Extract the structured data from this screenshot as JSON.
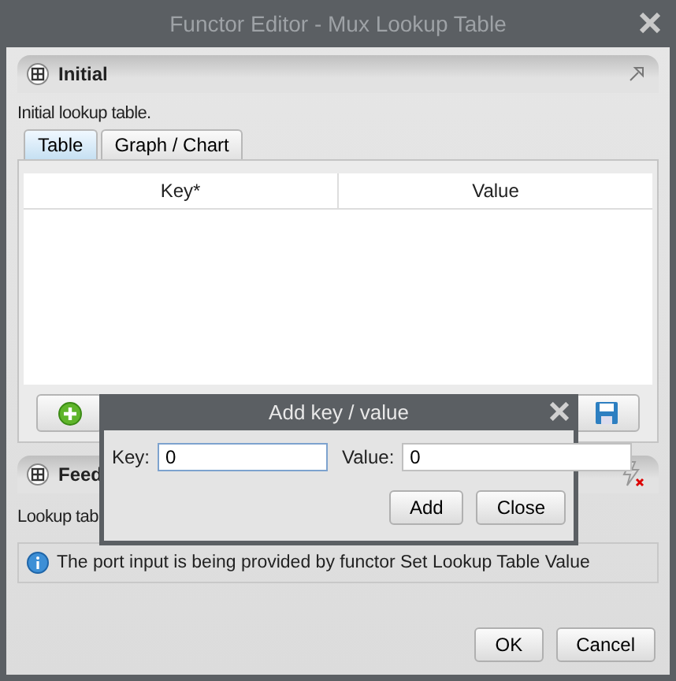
{
  "window": {
    "title": "Functor Editor - Mux Lookup Table"
  },
  "panels": [
    {
      "title": "Initial",
      "description": "Initial lookup table.",
      "kind": "table",
      "tabs": [
        {
          "label": "Table",
          "selected": true
        },
        {
          "label": "Graph / Chart",
          "selected": false
        }
      ],
      "columns": [
        "Key*",
        "Value"
      ]
    },
    {
      "title": "Feed",
      "description": "Lookup tab",
      "kind": "info",
      "info": "The port input is being provided by functor Set Lookup Table Value"
    }
  ],
  "dialog": {
    "title": "Add key / value",
    "fields": [
      {
        "label": "Key:",
        "value": "0"
      },
      {
        "label": "Value:",
        "value": "0"
      }
    ],
    "buttons": [
      "Add",
      "Close"
    ]
  },
  "buttons": [
    "OK",
    "Cancel"
  ]
}
